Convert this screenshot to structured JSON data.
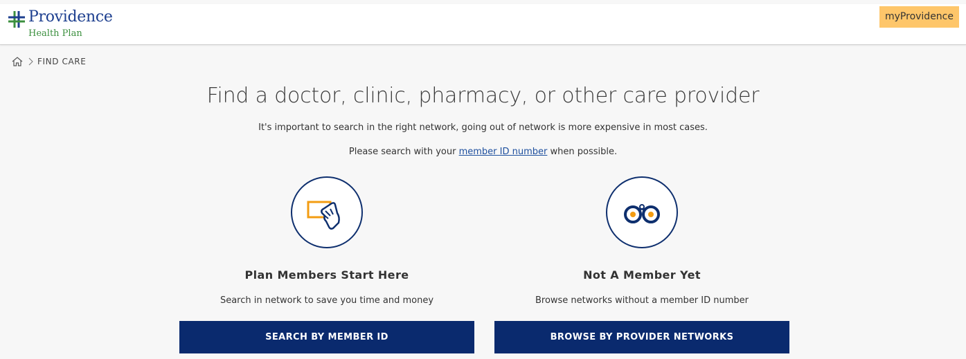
{
  "header": {
    "logo_name": "Providence",
    "logo_sub": "Health Plan",
    "my_button_label": "myProvidence"
  },
  "breadcrumb": {
    "home_icon": "home-icon",
    "separator_icon": "chevron-right-icon",
    "current": "FIND CARE"
  },
  "main": {
    "title": "Find a doctor, clinic, pharmacy, or other care provider",
    "intro": "It's important to search in the right network, going out of network is more expensive in most cases.",
    "intro2_before": "Please search with your ",
    "intro2_link": "member ID number",
    "intro2_after": " when possible."
  },
  "cards": [
    {
      "icon": "member-card-icon",
      "title": "Plan Members Start Here",
      "description": "Search in network to save you time and money",
      "button_label": "SEARCH BY MEMBER ID"
    },
    {
      "icon": "binoculars-icon",
      "title": "Not A Member Yet",
      "description": "Browse networks without a member ID number",
      "button_label": "BROWSE BY PROVIDER NETWORKS"
    }
  ],
  "colors": {
    "brand_blue": "#0a2a6e",
    "accent_orange": "#f39c12",
    "my_button_bg": "#fec66a",
    "logo_green": "#3b8f3e",
    "link_blue": "#1d4f9e"
  }
}
